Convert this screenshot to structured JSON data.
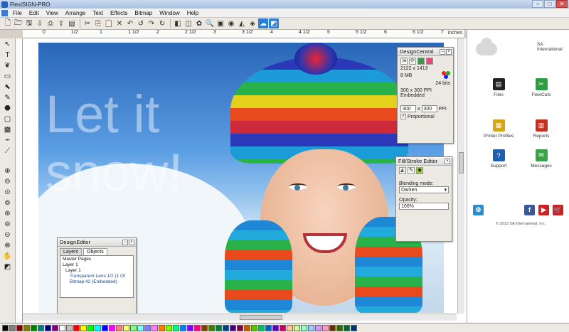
{
  "window": {
    "title": "FlexiSIGN-PRO",
    "minimize": "–",
    "maximize": "□",
    "close": "✕"
  },
  "menu": [
    "File",
    "Edit",
    "View",
    "Arrange",
    "Text",
    "Effects",
    "Bitmap",
    "Window",
    "Help"
  ],
  "ruler": {
    "units": "inches",
    "ticks": [
      "0",
      "1/2",
      "1",
      "1 1/2",
      "2",
      "2 1/2",
      "3",
      "3 1/2",
      "4",
      "4 1/2",
      "5",
      "5 1/2",
      "6",
      "6 1/2",
      "7"
    ]
  },
  "canvas": {
    "headline": "Let it\nsnow!"
  },
  "design_central": {
    "title": "DesignCentral",
    "size": "2122 x 1413",
    "mem": "8 MB",
    "bits": "24 bits",
    "ppi": "300 x 300 PPI",
    "embedded": "Embedded",
    "ppi_x": "300",
    "ppi_y": "300",
    "x_sep": "x",
    "ppi_unit": "PPI",
    "proportional": "Proportional"
  },
  "fill_stroke": {
    "title": "Fill/Stroke Editor",
    "blending_label": "Blending mode:",
    "blending_value": "Darken",
    "opacity_label": "Opacity:",
    "opacity_value": "100%"
  },
  "design_editor": {
    "title": "DesignEditor",
    "tabs": [
      "Layers",
      "Objects"
    ],
    "tree": [
      "Master Pages",
      "Layer 1",
      "Layer 1",
      "Transparent Lens 1/2 (1 Of",
      "Bitmap 42 (Embedded)"
    ]
  },
  "side_panel": {
    "brand": "SA International",
    "items": [
      {
        "label": "Files",
        "color": "#222222",
        "glyph": "▤"
      },
      {
        "label": "FlexiCuts",
        "color": "#2e9e44",
        "glyph": "✂"
      },
      {
        "label": "Printer Profiles",
        "color": "#d4a516",
        "glyph": "▦"
      },
      {
        "label": "Reports",
        "color": "#c8301e",
        "glyph": "▥"
      },
      {
        "label": "Support",
        "color": "#1f5fb0",
        "glyph": "?"
      },
      {
        "label": "Messages",
        "color": "#3aa34a",
        "glyph": "✉"
      }
    ],
    "social": [
      {
        "glyph": "⚙",
        "color": "#2a8fd0"
      },
      {
        "glyph": "f",
        "color": "#3b5998"
      },
      {
        "glyph": "▶",
        "color": "#cc2222"
      },
      {
        "glyph": "🛒",
        "color": "#cc2222"
      }
    ],
    "copyright": "© 2013 SA International, Inc."
  },
  "colors": {
    "accent": "#2a7fd4",
    "palette": [
      "#000000",
      "#808080",
      "#800000",
      "#808000",
      "#008000",
      "#008080",
      "#000080",
      "#800080",
      "#ffffff",
      "#c0c0c0",
      "#ff0000",
      "#ffff00",
      "#00ff00",
      "#00ffff",
      "#0000ff",
      "#ff00ff",
      "#ff8080",
      "#ffff80",
      "#80ff80",
      "#80ffff",
      "#8080ff",
      "#ff80ff",
      "#ff8000",
      "#80ff00",
      "#00ff80",
      "#0080ff",
      "#8000ff",
      "#ff0080",
      "#804000",
      "#408000",
      "#008040",
      "#004080",
      "#400080",
      "#800040",
      "#c06000",
      "#60c000",
      "#00c060",
      "#0060c0",
      "#6000c0",
      "#c00060",
      "#ffcc99",
      "#ccff99",
      "#99ffcc",
      "#99ccff",
      "#cc99ff",
      "#ff99cc",
      "#663300",
      "#336600",
      "#006633",
      "#003366"
    ]
  }
}
